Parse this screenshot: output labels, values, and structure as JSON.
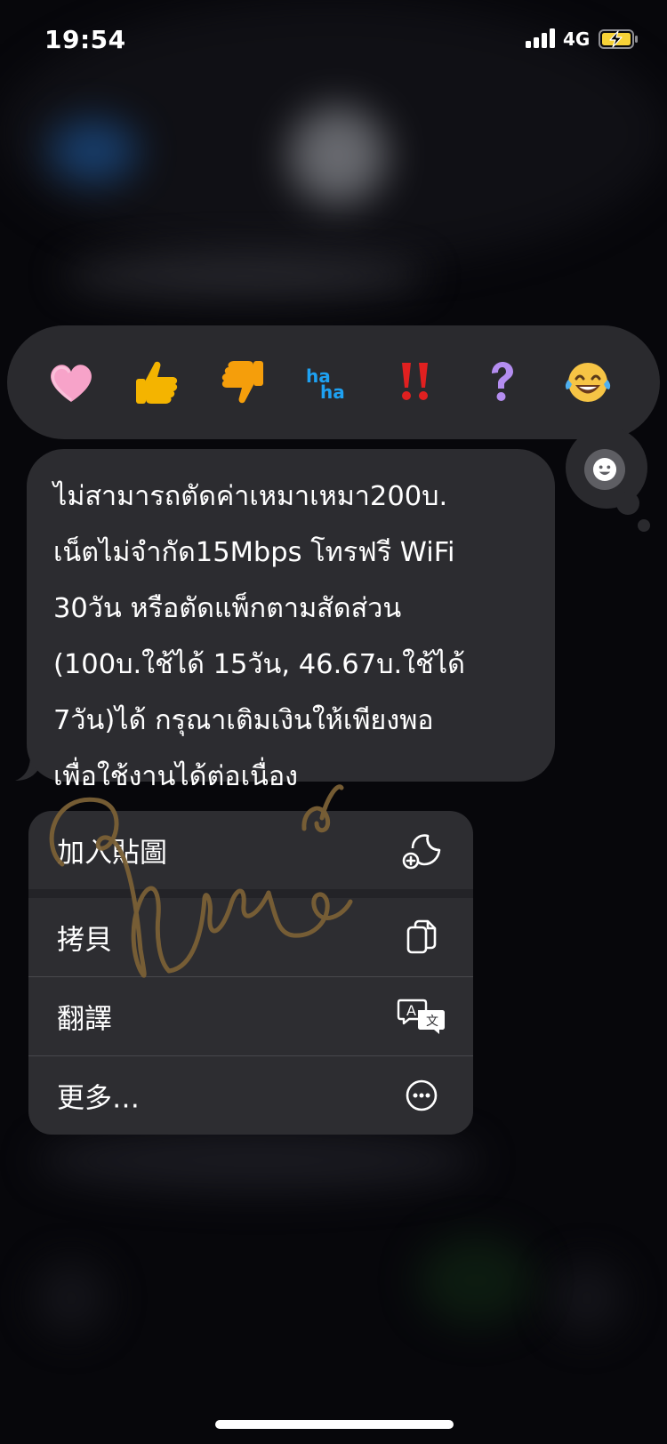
{
  "status_bar": {
    "time": "19:54",
    "network": "4G",
    "battery_charging": true
  },
  "reactions": [
    {
      "name": "heart",
      "icon": "heart-icon"
    },
    {
      "name": "thumbs-up",
      "icon": "thumbs-up-icon"
    },
    {
      "name": "thumbs-down",
      "icon": "thumbs-down-icon"
    },
    {
      "name": "haha",
      "icon": "haha-icon"
    },
    {
      "name": "exclamation",
      "icon": "double-exclamation-icon"
    },
    {
      "name": "question",
      "icon": "question-icon"
    },
    {
      "name": "laughing",
      "icon": "tears-of-joy-icon"
    }
  ],
  "message": {
    "text": "ไม่สามารถตัดค่าเหมาเหมา200บ.\nเน็ตไม่จำกัด15Mbps โทรฟรี WiFi\n30วัน หรือตัดแพ็กตามสัดส่วน\n(100บ.ใช้ได้ 15วัน, 46.67บ.ใช้ได้\n7วัน)ได้ กรุณาเติมเงินให้เพียงพอ\nเพื่อใช้งานได้ต่อเนื่อง"
  },
  "context_menu": {
    "items": [
      {
        "label": "加入貼圖",
        "icon": "add-sticker-icon"
      },
      {
        "label": "拷貝",
        "icon": "copy-icon"
      },
      {
        "label": "翻譯",
        "icon": "translate-icon"
      },
      {
        "label": "更多…",
        "icon": "more-icon"
      }
    ]
  },
  "colors": {
    "bubble": "#2c2c30",
    "reaction_bar": "#2a2a2e",
    "menu": "#2d2d31",
    "scribble": "#7a6036"
  }
}
